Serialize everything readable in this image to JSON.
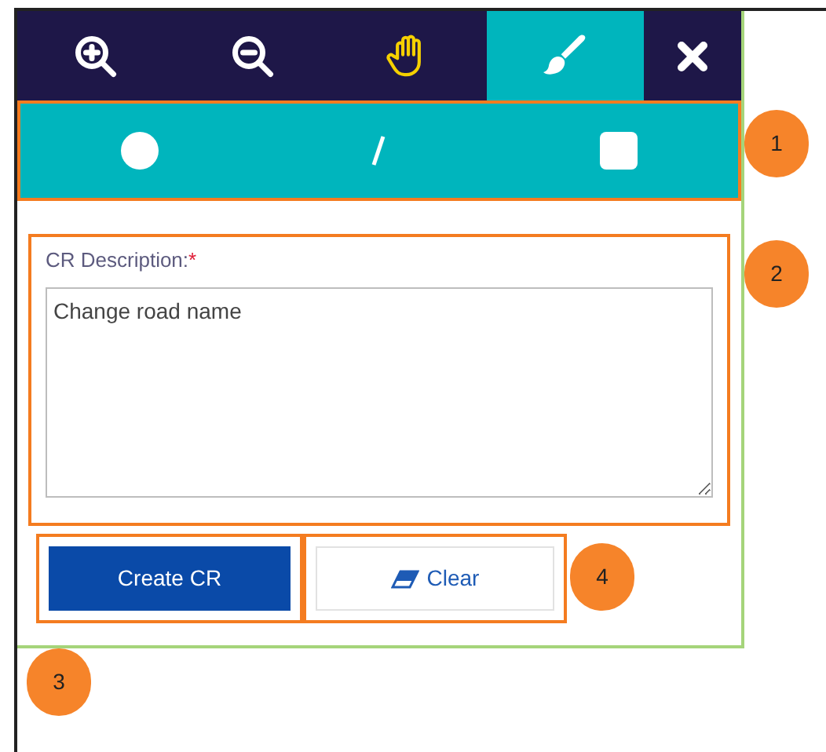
{
  "toolbar": {
    "tools": [
      {
        "kind": "zoom-in",
        "selected": false
      },
      {
        "kind": "zoom-out",
        "selected": false
      },
      {
        "kind": "pan",
        "selected": false
      },
      {
        "kind": "draw",
        "selected": true
      },
      {
        "kind": "close",
        "selected": false
      }
    ]
  },
  "shapes": [
    {
      "kind": "circle"
    },
    {
      "kind": "line"
    },
    {
      "kind": "square"
    }
  ],
  "form": {
    "label": "CR Description:",
    "required_mark": "*",
    "value": "Change road name"
  },
  "buttons": [
    {
      "kind": "primary",
      "label": "Create CR"
    },
    {
      "kind": "clear",
      "label": "Clear"
    }
  ],
  "annotations": [
    {
      "number": "1"
    },
    {
      "number": "2"
    },
    {
      "number": "3"
    },
    {
      "number": "4"
    }
  ]
}
